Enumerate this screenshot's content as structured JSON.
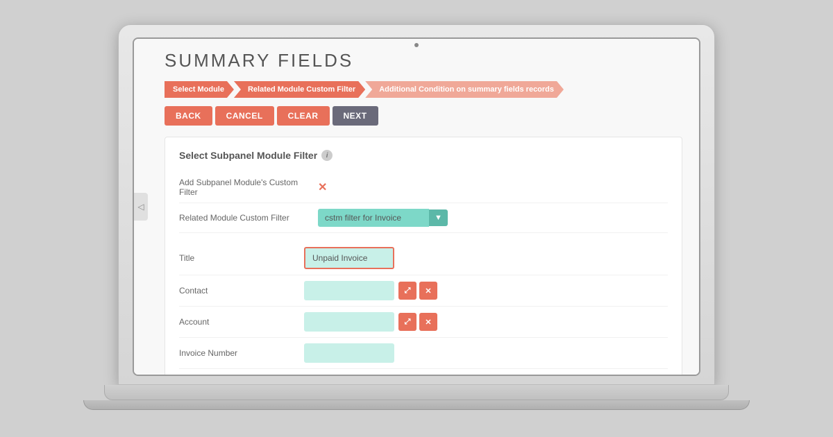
{
  "page": {
    "title": "SUMMARY FIELDS",
    "camera_dot": true
  },
  "breadcrumbs": [
    {
      "id": "step1",
      "label": "Select Module",
      "active": true
    },
    {
      "id": "step2",
      "label": "Related Module Custom Filter",
      "active": true
    },
    {
      "id": "step3",
      "label": "Additional Condition on summary fields records",
      "active": false
    }
  ],
  "toolbar": {
    "back_label": "BACK",
    "cancel_label": "CANCEL",
    "clear_label": "CLEAR",
    "next_label": "NEXT"
  },
  "panel": {
    "title": "Select Subpanel Module Filter",
    "info_icon": "i",
    "add_filter_label": "Add Subpanel Module's Custom Filter",
    "related_filter_label": "Related Module Custom Filter",
    "related_filter_value": "cstm filter for Invoice",
    "table_rows": [
      {
        "id": "title-row",
        "label": "Title",
        "value": "Unpaid Invoice",
        "highlighted": true,
        "has_actions": false
      },
      {
        "id": "contact-row",
        "label": "Contact",
        "value": "",
        "highlighted": false,
        "has_actions": true
      },
      {
        "id": "account-row",
        "label": "Account",
        "value": "",
        "highlighted": false,
        "has_actions": true
      },
      {
        "id": "invoice-row",
        "label": "Invoice Number",
        "value": "",
        "highlighted": false,
        "has_actions": false
      }
    ]
  },
  "icons": {
    "sidebar_toggle": "◁",
    "chevron_down": "▼",
    "link_icon": "⤢",
    "remove_icon": "✕",
    "x_mark": "✕"
  },
  "colors": {
    "salmon": "#e8705a",
    "teal": "#7dd8c8",
    "dark_teal": "#5cb8a8",
    "dark_btn": "#6a6a7a",
    "light_green_input": "#c8f0e8"
  }
}
